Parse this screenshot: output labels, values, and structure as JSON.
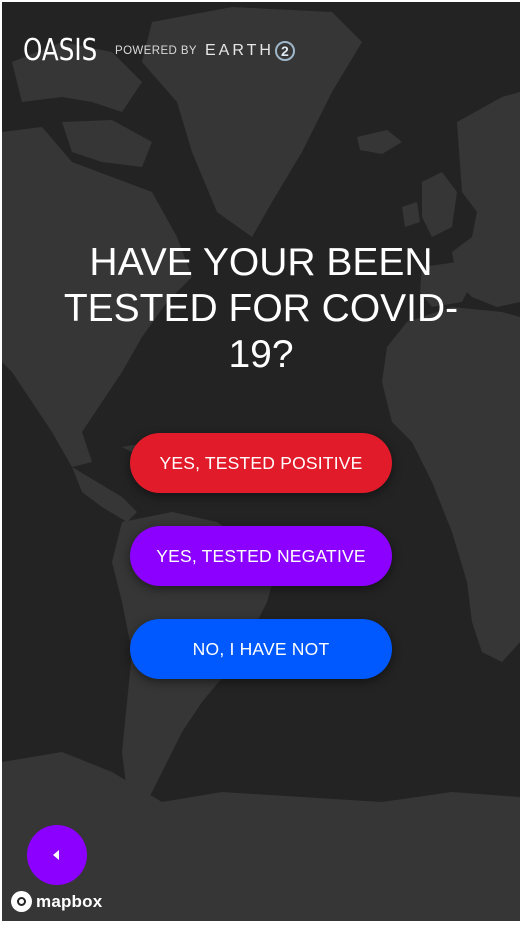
{
  "header": {
    "brand": "OASIS",
    "powered_by": "POWERED BY",
    "partner_text": "EARTH",
    "partner_badge": "2"
  },
  "question": {
    "title": "HAVE YOUR BEEN TESTED FOR COVID-19?"
  },
  "answers": [
    {
      "label": "YES, TESTED POSITIVE",
      "color": "#e21b2a"
    },
    {
      "label": "YES, TESTED NEGATIVE",
      "color": "#8b00ff"
    },
    {
      "label": "NO, I HAVE NOT",
      "color": "#0059ff"
    }
  ],
  "back_button": {
    "icon": "chevron-left-icon",
    "color": "#8b00ff"
  },
  "attribution": {
    "text": "mapbox",
    "icon": "mapbox-logo-icon"
  },
  "map": {
    "background": "#232323",
    "land": "#363636"
  }
}
